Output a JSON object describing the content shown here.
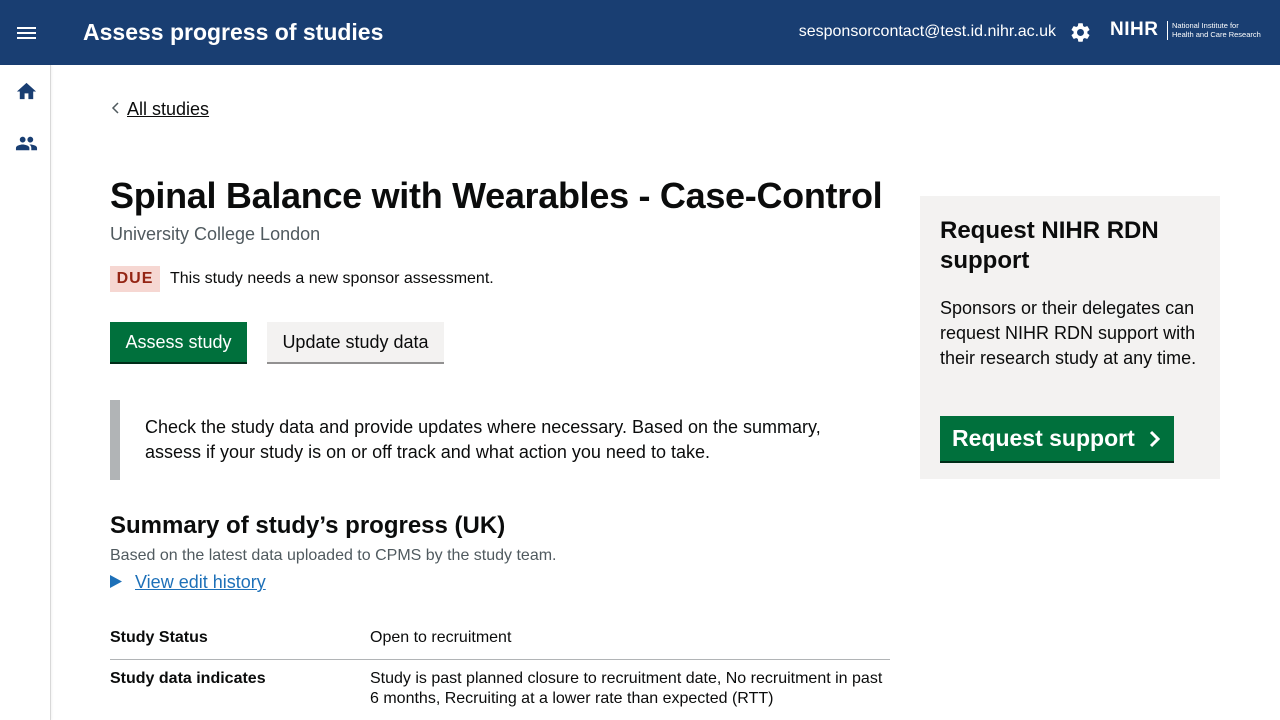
{
  "header": {
    "app_title": "Assess progress of studies",
    "user_email": "sesponsorcontact@test.id.nihr.ac.uk",
    "logo_mark": "NIHR",
    "logo_line1": "National Institute for",
    "logo_line2": "Health and Care Research",
    "icons": [
      "menu-icon",
      "gear-icon"
    ]
  },
  "sidebar": {
    "items": [
      {
        "icon": "home-icon"
      },
      {
        "icon": "people-icon"
      }
    ]
  },
  "breadcrumb": {
    "back_label": "All studies"
  },
  "study": {
    "title": "Spinal Balance with Wearables - Case-Control",
    "organisation": "University College London",
    "status_tag": "DUE",
    "status_message": "This study needs a new sponsor assessment."
  },
  "actions": {
    "assess_label": "Assess study",
    "update_label": "Update study data"
  },
  "inset": {
    "text": "Check the study data and provide updates where necessary. Based on the summary, assess if your study is on or off track and what action you need to take."
  },
  "summary": {
    "heading": "Summary of study’s progress (UK)",
    "subtext": "Based on the latest data uploaded to CPMS by the study team.",
    "history_link": "View edit history",
    "rows": [
      {
        "key": "Study Status",
        "value": "Open to recruitment"
      },
      {
        "key": "Study data indicates",
        "value": "Study is past planned closure to recruitment date, No recruitment in past 6 months, Recruiting at a lower rate than expected (RTT)"
      }
    ]
  },
  "support_panel": {
    "title": "Request NIHR RDN support",
    "body": "Sponsors or their delegates can request NIHR RDN support with their research study at any time.",
    "button_label": "Request support"
  },
  "colors": {
    "header_bg": "#193e72",
    "primary_button": "#00703c",
    "tag_bg": "#f6d7d2",
    "tag_text": "#942514",
    "link": "#1d70b8"
  }
}
